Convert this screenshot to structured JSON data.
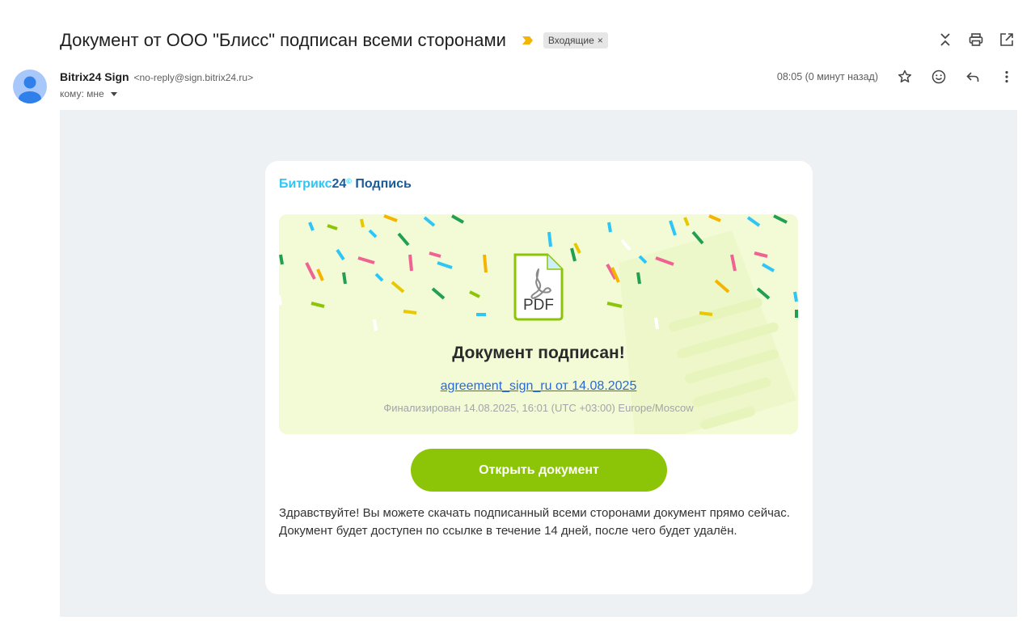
{
  "email": {
    "subject": "Документ от ООО \"Блисс\" подписан всеми сторонами",
    "label": "Входящие",
    "label_remove": "×",
    "sender_name": "Bitrix24 Sign",
    "sender_email": "<no-reply@sign.bitrix24.ru>",
    "to": "кому: мне",
    "time": "08:05 (0 минут назад)"
  },
  "icons": {
    "top": [
      "expand-collapse-icon",
      "print-icon",
      "open-new-window-icon"
    ],
    "sender": [
      "star-icon",
      "emoji-icon",
      "reply-icon",
      "more-vert-icon"
    ]
  },
  "card": {
    "brand_part1": "Битрикс",
    "brand_part2": "24",
    "brand_reg": "©",
    "brand_part3": " Подпись",
    "pdf_label": "PDF",
    "title": "Документ подписан!",
    "doc_link": "agreement_sign_ru от 14.08.2025",
    "finalized": "Финализирован 14.08.2025, 16:01 (UTC +03:00) Europe/Moscow",
    "button": "Открыть документ",
    "message": "Здравствуйте! Вы можете скачать подписанный всеми сторонами документ прямо сейчас. Документ будет доступен по ссылке в течение 14 дней, после чего будет удалён."
  },
  "colors": {
    "accent_green": "#8cc508",
    "banner_bg": "#f2fad6",
    "link_blue": "#2a6ad4",
    "brand_cyan": "#2fc6f6",
    "brand_navy": "#1a5b9a"
  }
}
